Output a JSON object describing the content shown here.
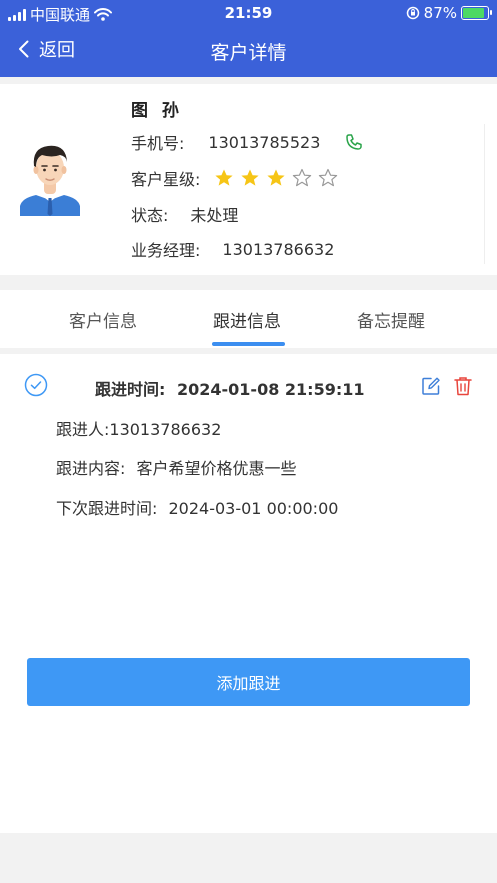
{
  "status_bar": {
    "carrier": "中国联通",
    "time": "21:59",
    "battery": "87%",
    "battery_level": 0.87
  },
  "nav": {
    "back_label": "返回",
    "title": "客户详情"
  },
  "customer": {
    "name": "图 孙",
    "phone_label": "手机号:",
    "phone": "13013785523",
    "level_label": "客户星级:",
    "rating": 3,
    "rating_max": 5,
    "status_label": "状态:",
    "status": "未处理",
    "manager_label": "业务经理:",
    "manager": "13013786632"
  },
  "tabs": [
    {
      "label": "客户信息",
      "active": false
    },
    {
      "label": "跟进信息",
      "active": true
    },
    {
      "label": "备忘提醒",
      "active": false
    }
  ],
  "followup": {
    "time_label": "跟进时间:",
    "time": "2024-01-08 21:59:11",
    "person": "跟进人:13013786632",
    "content_label": "跟进内容:",
    "content": "客户希望价格优惠一些",
    "next_label": "下次跟进时间:",
    "next_time": "2024-03-01 00:00:00"
  },
  "add_button": "添加跟进",
  "colors": {
    "header": "#3b61d9",
    "accent": "#3e98f5",
    "star": "#f6c516",
    "delete": "#e8453c",
    "phone_icon": "#2aa44a"
  }
}
